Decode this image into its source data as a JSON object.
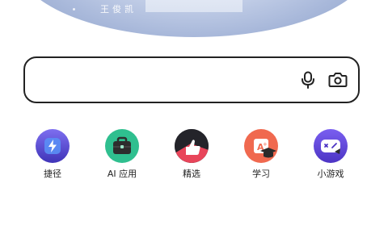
{
  "banner": {
    "caption": "王俊凯"
  },
  "search": {
    "value": "",
    "placeholder": "",
    "icons": [
      "mic-icon",
      "camera-icon"
    ]
  },
  "quick_entries": [
    {
      "label": "捷径",
      "icon": "lightning-icon",
      "color": "#5b4fd6"
    },
    {
      "label": "AI 应用",
      "icon": "briefcase-icon",
      "color": "#2fbf8f"
    },
    {
      "label": "精选",
      "icon": "thumbs-up-icon",
      "color": "#e8455a"
    },
    {
      "label": "学习",
      "icon": "study-icon",
      "color": "#f0694f"
    },
    {
      "label": "小游戏",
      "icon": "gamepad-icon",
      "color": "#6a4fe0"
    }
  ],
  "colors": {
    "search_border": "#222222",
    "text": "#222222",
    "background": "#ffffff"
  }
}
